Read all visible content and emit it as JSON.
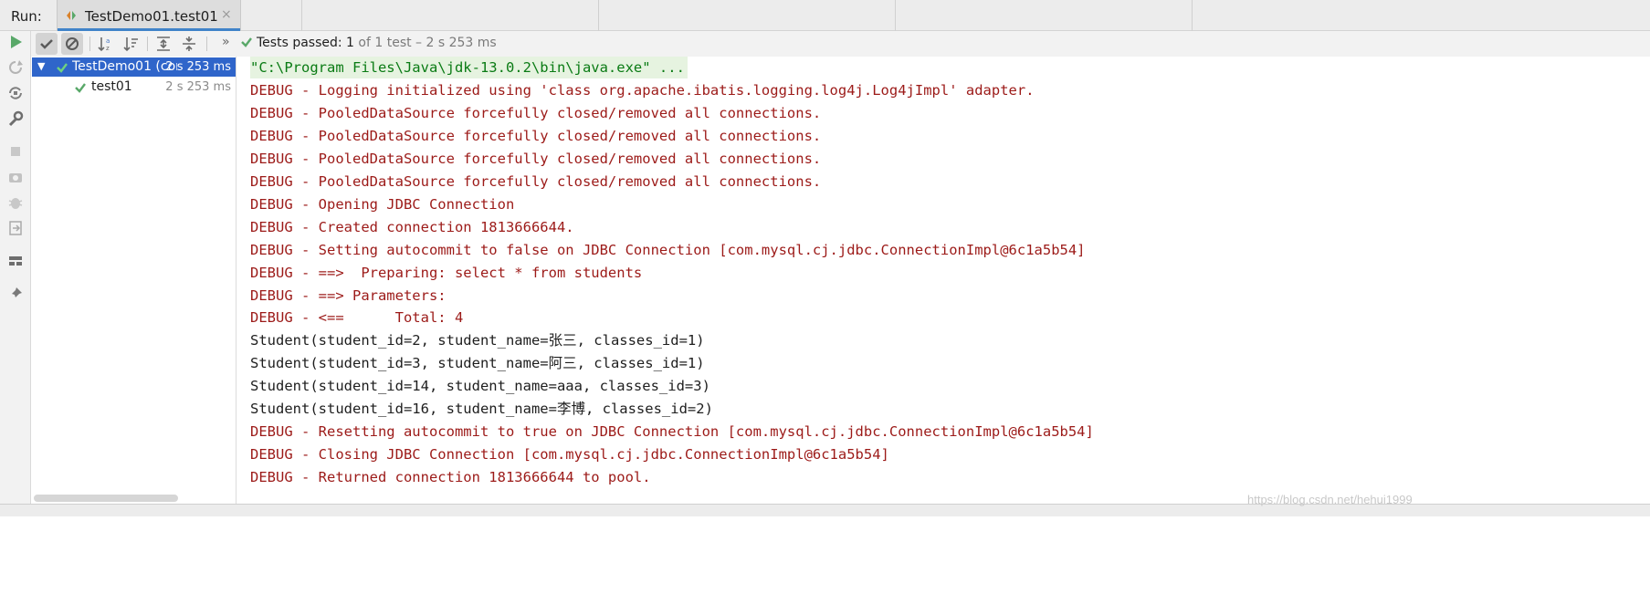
{
  "titlebar": {
    "run_label": "Run:",
    "tab_title": "TestDemo01.test01",
    "tab_close": "×"
  },
  "toolbar": {
    "chevrons": "»",
    "status_prefix": "Tests passed: ",
    "status_count": "1",
    "status_suffix": " of 1 test – 2 s 253 ms"
  },
  "tree": {
    "items": [
      {
        "name": "TestDemo01 (com",
        "time": "2 s 253 ms",
        "expanded": true,
        "selected": true
      },
      {
        "name": "test01",
        "time": "2 s 253 ms",
        "selected": false
      }
    ]
  },
  "console": {
    "lines": [
      {
        "text": "\"C:\\Program Files\\Java\\jdk-13.0.2\\bin\\java.exe\" ...",
        "kind": "cmd"
      },
      {
        "text": "DEBUG - Logging initialized using 'class org.apache.ibatis.logging.log4j.Log4jImpl' adapter.",
        "kind": "debug"
      },
      {
        "text": "DEBUG - PooledDataSource forcefully closed/removed all connections.",
        "kind": "debug"
      },
      {
        "text": "DEBUG - PooledDataSource forcefully closed/removed all connections.",
        "kind": "debug"
      },
      {
        "text": "DEBUG - PooledDataSource forcefully closed/removed all connections.",
        "kind": "debug"
      },
      {
        "text": "DEBUG - PooledDataSource forcefully closed/removed all connections.",
        "kind": "debug"
      },
      {
        "text": "DEBUG - Opening JDBC Connection",
        "kind": "debug"
      },
      {
        "text": "DEBUG - Created connection 1813666644.",
        "kind": "debug"
      },
      {
        "text": "DEBUG - Setting autocommit to false on JDBC Connection [com.mysql.cj.jdbc.ConnectionImpl@6c1a5b54]",
        "kind": "debug"
      },
      {
        "text": "DEBUG - ==>  Preparing: select * from students",
        "kind": "debug"
      },
      {
        "text": "DEBUG - ==> Parameters: ",
        "kind": "debug"
      },
      {
        "text": "DEBUG - <==      Total: 4",
        "kind": "debug"
      },
      {
        "text": "Student(student_id=2, student_name=张三, classes_id=1)",
        "kind": "out"
      },
      {
        "text": "Student(student_id=3, student_name=阿三, classes_id=1)",
        "kind": "out"
      },
      {
        "text": "Student(student_id=14, student_name=aaa, classes_id=3)",
        "kind": "out"
      },
      {
        "text": "Student(student_id=16, student_name=李博, classes_id=2)",
        "kind": "out"
      },
      {
        "text": "DEBUG - Resetting autocommit to true on JDBC Connection [com.mysql.cj.jdbc.ConnectionImpl@6c1a5b54]",
        "kind": "debug"
      },
      {
        "text": "DEBUG - Closing JDBC Connection [com.mysql.cj.jdbc.ConnectionImpl@6c1a5b54]",
        "kind": "debug"
      },
      {
        "text": "DEBUG - Returned connection 1813666644 to pool.",
        "kind": "debug"
      }
    ]
  },
  "watermark": "https://blog.csdn.net/hehui1999",
  "icons": {
    "tab": "run-config-icon",
    "left_toolbar": [
      "run-icon",
      "rerun-failed-icon",
      "toggle-auto-test-icon",
      "wrench-icon",
      "stop-icon",
      "camera-icon",
      "bug-icon",
      "exit-icon",
      "layout-icon",
      "pin-icon"
    ],
    "top_toolbar": [
      "show-passed-icon",
      "show-ignored-icon",
      "sort-alpha-icon",
      "sort-duration-icon",
      "expand-all-icon",
      "collapse-all-icon"
    ]
  },
  "colors": {
    "selection": "#2f65ca",
    "pass_green": "#59a869",
    "debug_red": "#9c1a18",
    "cmd_green": "#0a7b14",
    "tab_accent": "#4083c9"
  }
}
